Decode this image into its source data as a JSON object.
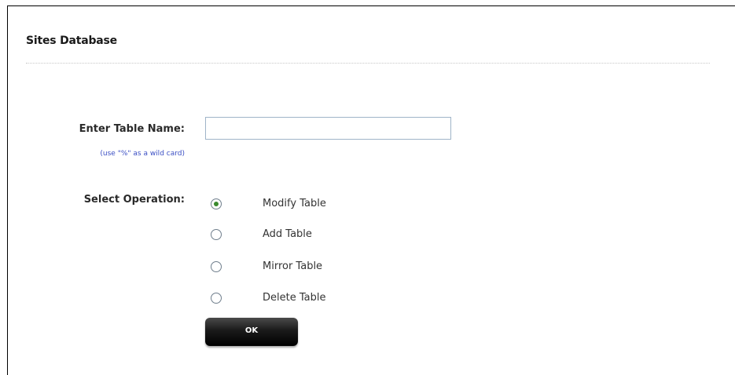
{
  "header": {
    "title": "Sites Database"
  },
  "form": {
    "table_name_label": "Enter Table Name:",
    "table_name_hint": "(use \"%\" as a wild card)",
    "table_name_value": "",
    "operation_label": "Select Operation:",
    "operations": [
      {
        "label": "Modify Table",
        "selected": true
      },
      {
        "label": "Add Table",
        "selected": false
      },
      {
        "label": "Mirror Table",
        "selected": false
      },
      {
        "label": "Delete Table",
        "selected": false
      }
    ],
    "submit_label": "OK"
  },
  "colors": {
    "hint_text": "#3b4fc4",
    "radio_selected": "#3a8a2e",
    "input_border": "#9fb4c8",
    "button_bg": "#111111"
  }
}
